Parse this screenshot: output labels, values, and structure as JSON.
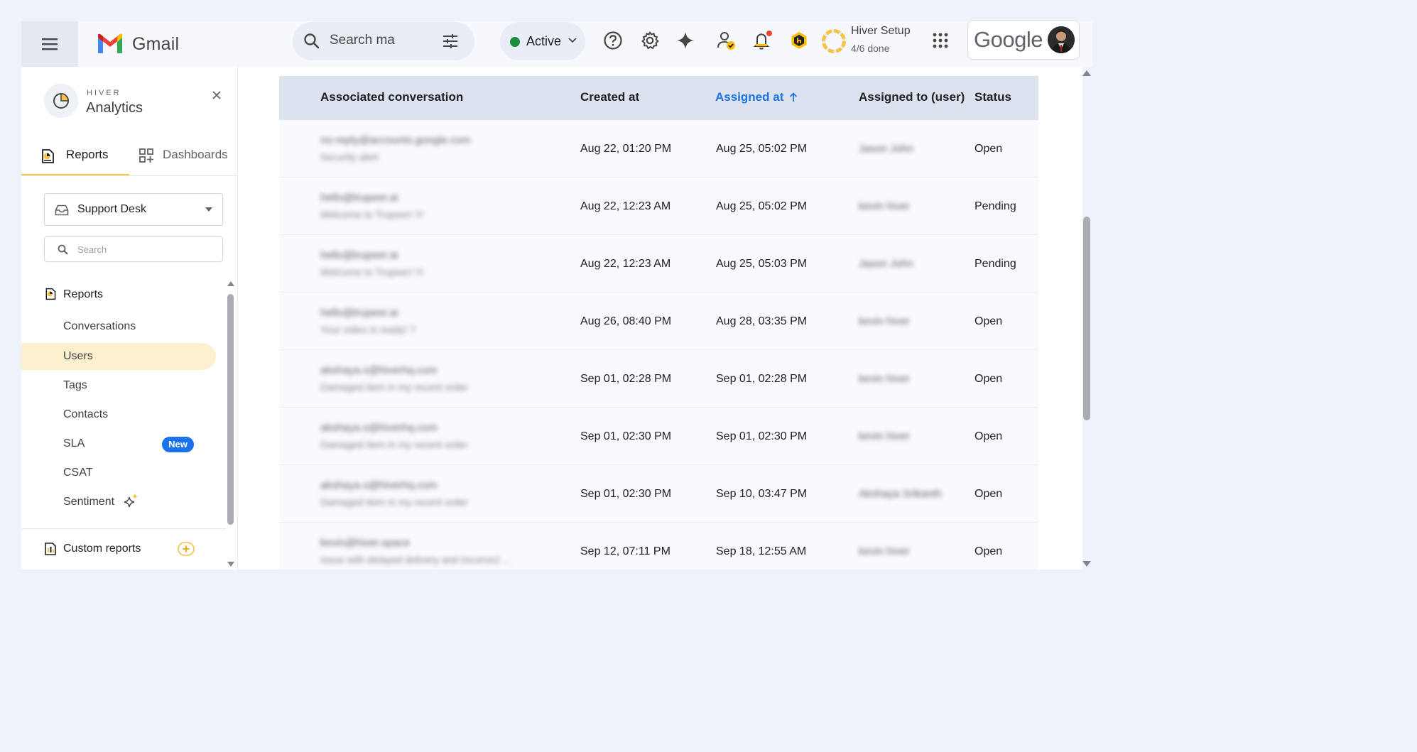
{
  "topbar": {
    "app_name": "Gmail",
    "search_text": "Search ma",
    "status_label": "Active",
    "status_color": "#1e8e3e",
    "setup_title": "Hiver Setup",
    "setup_progress": "4/6 done",
    "setup_fraction_done": 0.667,
    "account_wordmark": "Google",
    "icons": [
      "menu-icon",
      "search-icon",
      "tune-icon",
      "chevron-down-icon",
      "help-icon",
      "gear-icon",
      "sparkle-icon",
      "user-check-icon",
      "bell-icon",
      "hiver-badge-icon",
      "apps-grid-icon"
    ]
  },
  "sidebar": {
    "brand_small": "HIVER",
    "brand_title": "Analytics",
    "tabs": [
      {
        "label": "Reports",
        "active": true
      },
      {
        "label": "Dashboards",
        "active": false
      }
    ],
    "desk_select": "Support Desk",
    "search_placeholder": "Search",
    "section_title": "Reports",
    "items": [
      {
        "label": "Conversations",
        "selected": false
      },
      {
        "label": "Users",
        "selected": true
      },
      {
        "label": "Tags",
        "selected": false
      },
      {
        "label": "Contacts",
        "selected": false
      },
      {
        "label": "SLA",
        "selected": false,
        "badge": "New"
      },
      {
        "label": "CSAT",
        "selected": false
      },
      {
        "label": "Sentiment",
        "selected": false
      }
    ],
    "custom_reports": "Custom reports",
    "accent_color": "#f6c343"
  },
  "table": {
    "columns": {
      "conversation": "Associated conversation",
      "created": "Created at",
      "assigned": "Assigned at",
      "user": "Assigned to (user)",
      "status": "Status"
    },
    "sorted_column": "Assigned at",
    "sort_direction": "ascending",
    "rows": [
      {
        "from": "no-reply@accounts.google.com",
        "subject": "Security alert",
        "created": "Aug 22, 01:20 PM",
        "assigned": "Aug 25, 05:02 PM",
        "user": "Jason John",
        "status": "Open"
      },
      {
        "from": "hello@trupeer.ai",
        "subject": "Welcome to Trupeer! !!!",
        "created": "Aug 22, 12:23 AM",
        "assigned": "Aug 25, 05:02 PM",
        "user": "kevin hiver",
        "status": "Pending"
      },
      {
        "from": "hello@trupeer.ai",
        "subject": "Welcome to Trupeer! !!!",
        "created": "Aug 22, 12:23 AM",
        "assigned": "Aug 25, 05:03 PM",
        "user": "Jason John",
        "status": "Pending"
      },
      {
        "from": "hello@trupeer.ai",
        "subject": "Your video is ready! ?",
        "created": "Aug 26, 08:40 PM",
        "assigned": "Aug 28, 03:35 PM",
        "user": "kevin hiver",
        "status": "Open"
      },
      {
        "from": "akshaya.s@hiverhq.com",
        "subject": "Damaged item in my recent order",
        "created": "Sep 01, 02:28 PM",
        "assigned": "Sep 01, 02:28 PM",
        "user": "kevin hiver",
        "status": "Open"
      },
      {
        "from": "akshaya.s@hiverhq.com",
        "subject": "Damaged item in my recent order",
        "created": "Sep 01, 02:30 PM",
        "assigned": "Sep 01, 02:30 PM",
        "user": "kevin hiver",
        "status": "Open"
      },
      {
        "from": "akshaya.s@hiverhq.com",
        "subject": "Damaged item in my recent order",
        "created": "Sep 01, 02:30 PM",
        "assigned": "Sep 10, 03:47 PM",
        "user": "Akshaya Srikanth",
        "status": "Open"
      },
      {
        "from": "kevin@hiver.space",
        "subject": "Issue with delayed delivery and incorrect ...",
        "created": "Sep 12, 07:11 PM",
        "assigned": "Sep 18, 12:55 AM",
        "user": "kevin hiver",
        "status": "Open"
      }
    ]
  }
}
